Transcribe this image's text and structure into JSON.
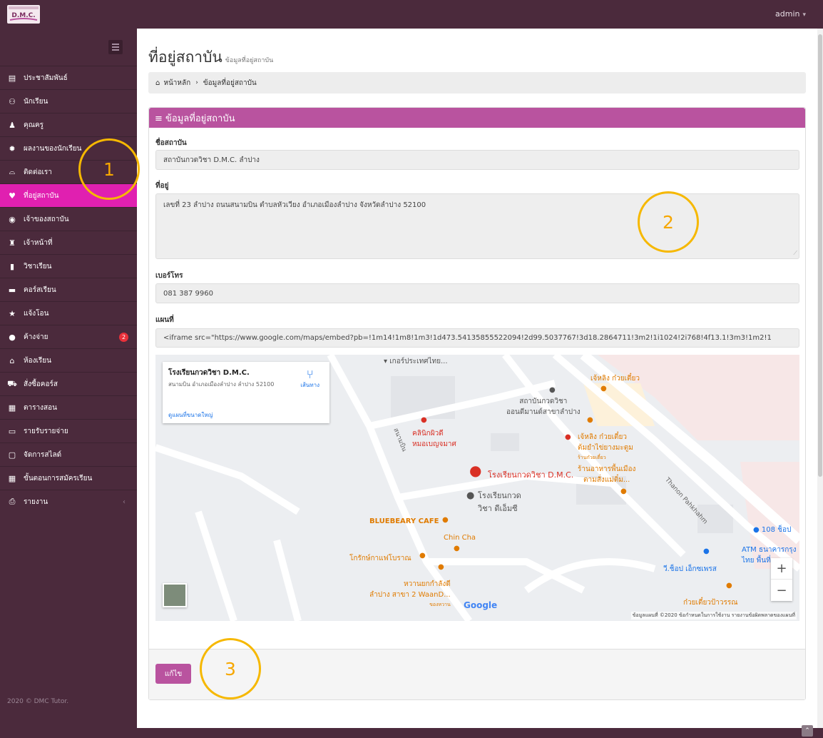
{
  "app": {
    "logo_text": "D.M.C.",
    "user": "admin",
    "footer": "2020 © DMC Tutor."
  },
  "sidebar": {
    "items": [
      {
        "label": "ประชาสัมพันธ์",
        "icon": "newspaper-icon"
      },
      {
        "label": "นักเรียน",
        "icon": "users-icon"
      },
      {
        "label": "คุณครู",
        "icon": "user-icon"
      },
      {
        "label": "ผลงานของนักเรียน",
        "icon": "gear-icon"
      },
      {
        "label": "ติดต่อเรา",
        "icon": "inbox-icon"
      },
      {
        "label": "ที่อยู่สถาบัน",
        "icon": "map-marker-icon",
        "active": true
      },
      {
        "label": "เจ้าของสถาบัน",
        "icon": "user-circle-icon"
      },
      {
        "label": "เจ้าหน้าที่",
        "icon": "user-secret-icon"
      },
      {
        "label": "วิชาเรียน",
        "icon": "file-icon"
      },
      {
        "label": "คอร์สเรียน",
        "icon": "book-icon"
      },
      {
        "label": "แจ้งโอน",
        "icon": "star-icon"
      },
      {
        "label": "ค้างจ่าย",
        "icon": "info-icon",
        "badge": "2"
      },
      {
        "label": "ห้องเรียน",
        "icon": "home-icon"
      },
      {
        "label": "สั่งซื้อคอร์ส",
        "icon": "cart-icon"
      },
      {
        "label": "ตารางสอน",
        "icon": "calendar-icon"
      },
      {
        "label": "รายรับรายจ่าย",
        "icon": "money-icon"
      },
      {
        "label": "จัดการสไลด์",
        "icon": "desktop-icon"
      },
      {
        "label": "ขั้นตอนการสมัครเรียน",
        "icon": "table-icon"
      },
      {
        "label": "รายงาน",
        "icon": "print-icon",
        "caret": "‹"
      }
    ]
  },
  "page": {
    "title": "ที่อยู่สถาบัน",
    "subtitle": "ข้อมูลที่อยู่สถาบัน",
    "breadcrumb_home": "หน้าหลัก",
    "breadcrumb_current": "ข้อมูลที่อยู่สถาบัน"
  },
  "panel": {
    "heading": "≡ ข้อมูลที่อยู่สถาบัน",
    "name_label": "ชื่อสถาบัน",
    "name_value": "สถาบันกวดวิชา D.M.C. ลำปาง",
    "address_label": "ที่อยู่",
    "address_value": "เลขที่ 23 ลำปาง ถนนสนามบิน ตำบลหัวเวียง อำเภอเมืองลำปาง จังหวัดลำปาง 52100",
    "phone_label": "เบอร์โทร",
    "phone_value": "081 387 9960",
    "map_label": "แผนที่",
    "map_value": "<iframe src=\"https://www.google.com/maps/embed?pb=!1m14!1m8!1m3!1d473.54135855522094!2d99.5037767!3d18.2864711!3m2!1i1024!2i768!4f13.1!3m3!1m2!1",
    "edit_button": "แก้ไข"
  },
  "map": {
    "card_title": "โรงเรียนกวดวิชา D.M.C.",
    "card_address": "สนามบิน อำเภอเมืองลำปาง ลำปาง 52100",
    "card_link": "ดูแผนที่ขนาดใหญ่",
    "card_directions": "เส้นทาง",
    "poi_1": "เกอร์ประเทศไทย...",
    "poi_2": "เจ้หลิง ก๋วยเตี๋ยว",
    "poi_3": "สถาบันกวดวิชา",
    "poi_3b": "ออนดีมานด์สาขาลำปาง",
    "poi_4": "คลินิกผิวดี",
    "poi_4b": "หมอเบญจมาศ",
    "poi_5": "เจ้หลิง ก๋วยเตี๋ยว",
    "poi_5b": "ต้มยำไข่ยางมะตูม",
    "poi_5c": "ร้านก๋วยเตี๋ยว",
    "poi_6": "โรงเรียนกวดวิชา D.M.C.",
    "poi_7": "ร้านอาหารพื้นเมือง",
    "poi_7b": "ตามสั่งแม่ติ๋ม...",
    "poi_8": "โรงเรียนกวด",
    "poi_8b": "วิชา ดีเอ็มซี",
    "poi_9": "BLUEBEARY CAFE",
    "poi_10": "Chin Cha",
    "poi_11": "โกรักษ์กาแฟโบราณ",
    "poi_12": "หวานยกกำลังดี",
    "poi_12b": "ลำปาง สาขา 2 WaanD...",
    "poi_12c": "ของหวาน",
    "poi_13": "108 ช็อป",
    "poi_14": "ATM ธนาคารกรุง",
    "poi_14b": "ไทย พื้นที่...",
    "poi_15": "วี.ช็อป เอ็กซเพรส",
    "poi_16": "ก๋วยเตี๋ยวป้าวรรณ",
    "road_1": "สนามบิน",
    "road_2": "Thanon Pahkhahm",
    "zoom_in": "+",
    "zoom_out": "−",
    "google": "Google",
    "attribution": "ข้อมูลแผนที่ ©2020   ข้อกำหนดในการใช้งาน   รายงานข้อผิดพลาดของแผนที่"
  },
  "annotations": [
    "1",
    "2",
    "3"
  ],
  "colors": {
    "sidebar": "#4b2a3c",
    "active": "#e020b0",
    "accent": "#b9539f",
    "annotation": "#f6b800"
  }
}
